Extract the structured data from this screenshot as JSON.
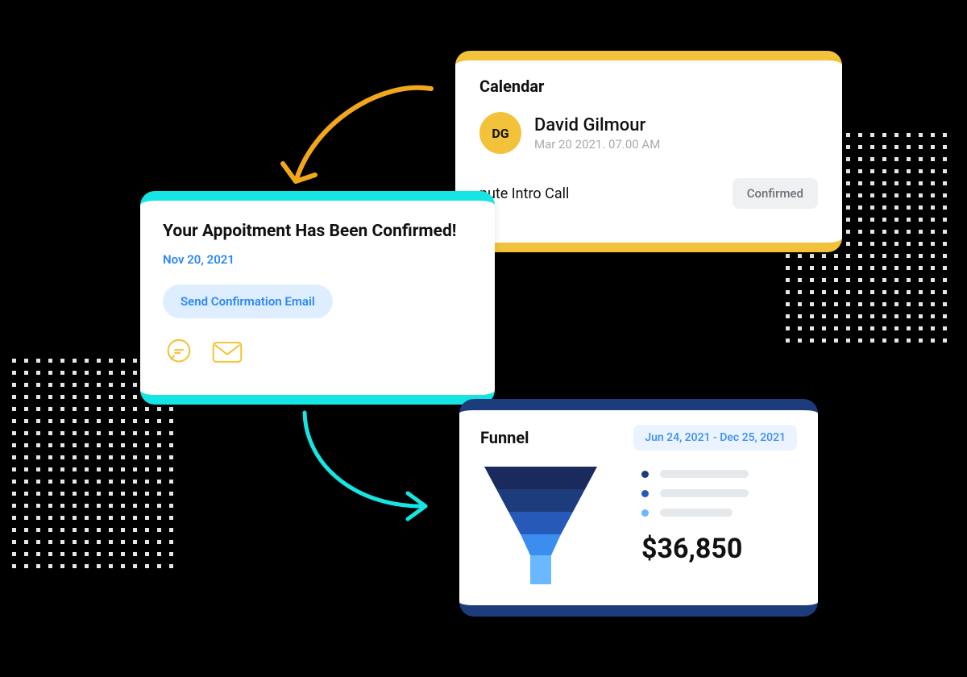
{
  "calendar": {
    "title": "Calendar",
    "avatar_initials": "DG",
    "contact_name": "David Gilmour",
    "contact_datetime": "Mar 20 2021. 07.00 AM",
    "call_type": "nute Intro Call",
    "status": "Confirmed"
  },
  "appointment": {
    "title": "Your Appoitment Has Been Confirmed!",
    "date": "Nov 20, 2021",
    "button_label": "Send Confirmation Email"
  },
  "funnel": {
    "title": "Funnel",
    "date_range": "Jun 24, 2021 -  Dec 25, 2021",
    "amount": "$36,850",
    "colors": [
      "#1a2a5c",
      "#1c3c7c",
      "#2759b8",
      "#3b8ef0",
      "#6ab8ff"
    ]
  },
  "colors": {
    "yellow": "#f2c33a",
    "cyan": "#15e6e4",
    "navy": "#1c3c7c",
    "blue_text": "#2b88f5"
  }
}
